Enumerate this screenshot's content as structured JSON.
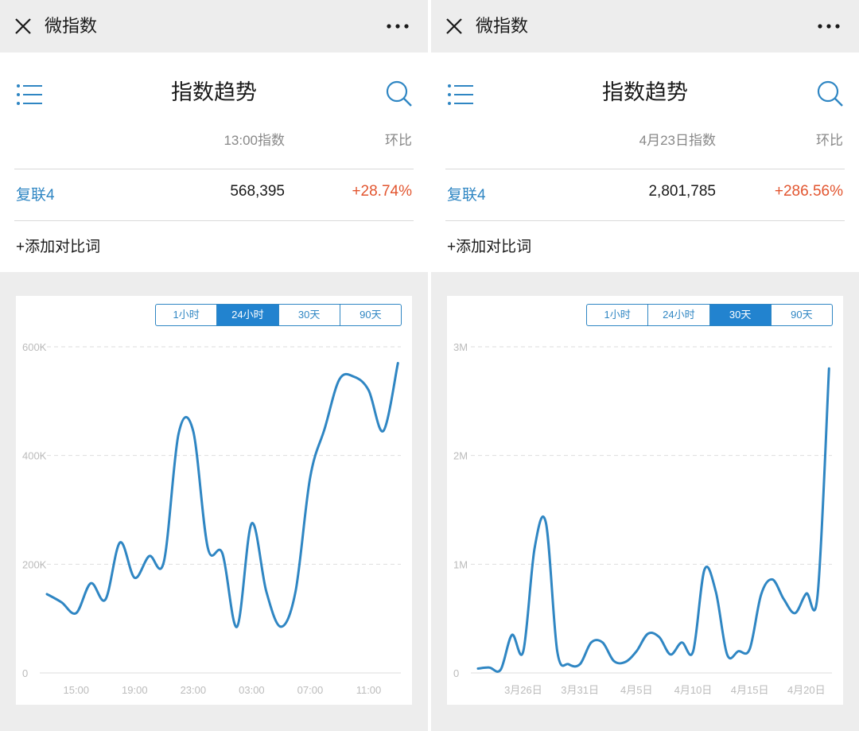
{
  "panels": [
    {
      "topbar_title": "微指数",
      "page_title": "指数趋势",
      "col_index_label": "13:00指数",
      "col_ratio_label": "环比",
      "row": {
        "name": "复联4",
        "value": "568,395",
        "change": "+28.74%"
      },
      "add_compare": "+添加对比词",
      "tabs": [
        "1小时",
        "24小时",
        "30天",
        "90天"
      ],
      "active_tab": 1,
      "chart_data": {
        "type": "line",
        "x_ticks": [
          "15:00",
          "19:00",
          "23:00",
          "03:00",
          "07:00",
          "11:00"
        ],
        "y_ticks": [
          "0",
          "200K",
          "400K",
          "600K"
        ],
        "ylim": [
          0,
          600000
        ],
        "grid": true,
        "series": [
          {
            "color": "#2f86c3",
            "points": [
              [
                0,
                145000
              ],
              [
                0.5,
                130000
              ],
              [
                1,
                110000
              ],
              [
                1.5,
                165000
              ],
              [
                2,
                135000
              ],
              [
                2.5,
                240000
              ],
              [
                3,
                175000
              ],
              [
                3.5,
                215000
              ],
              [
                4,
                205000
              ],
              [
                4.5,
                440000
              ],
              [
                5,
                445000
              ],
              [
                5.5,
                230000
              ],
              [
                6,
                220000
              ],
              [
                6.5,
                85000
              ],
              [
                7,
                275000
              ],
              [
                7.5,
                150000
              ],
              [
                8,
                85000
              ],
              [
                8.5,
                150000
              ],
              [
                9,
                360000
              ],
              [
                9.5,
                450000
              ],
              [
                10,
                540000
              ],
              [
                10.5,
                545000
              ],
              [
                11,
                520000
              ],
              [
                11.5,
                445000
              ],
              [
                12,
                570000
              ]
            ],
            "x_tick_positions": [
              1,
              3,
              5,
              7,
              9,
              11
            ]
          }
        ]
      }
    },
    {
      "topbar_title": "微指数",
      "page_title": "指数趋势",
      "col_index_label": "4月23日指数",
      "col_ratio_label": "环比",
      "row": {
        "name": "复联4",
        "value": "2,801,785",
        "change": "+286.56%"
      },
      "add_compare": "+添加对比词",
      "tabs": [
        "1小时",
        "24小时",
        "30天",
        "90天"
      ],
      "active_tab": 2,
      "chart_data": {
        "type": "line",
        "x_ticks": [
          "3月26日",
          "3月31日",
          "4月5日",
          "4月10日",
          "4月15日",
          "4月20日"
        ],
        "y_ticks": [
          "0",
          "1M",
          "2M",
          "3M"
        ],
        "ylim": [
          0,
          3000000
        ],
        "grid": true,
        "series": [
          {
            "color": "#2f86c3",
            "points": [
              [
                0,
                40000
              ],
              [
                1,
                50000
              ],
              [
                2,
                30000
              ],
              [
                3,
                350000
              ],
              [
                4,
                200000
              ],
              [
                5,
                1150000
              ],
              [
                6,
                1380000
              ],
              [
                7,
                200000
              ],
              [
                8,
                80000
              ],
              [
                9,
                80000
              ],
              [
                10,
                280000
              ],
              [
                11,
                280000
              ],
              [
                12,
                110000
              ],
              [
                13,
                100000
              ],
              [
                14,
                200000
              ],
              [
                15,
                360000
              ],
              [
                16,
                330000
              ],
              [
                17,
                170000
              ],
              [
                18,
                280000
              ],
              [
                19,
                200000
              ],
              [
                20,
                950000
              ],
              [
                21,
                750000
              ],
              [
                22,
                170000
              ],
              [
                23,
                200000
              ],
              [
                24,
                220000
              ],
              [
                25,
                720000
              ],
              [
                26,
                860000
              ],
              [
                27,
                680000
              ],
              [
                28,
                550000
              ],
              [
                29,
                730000
              ],
              [
                30,
                720000
              ],
              [
                31,
                2800000
              ]
            ],
            "x_tick_positions": [
              4,
              9,
              14,
              19,
              24,
              29
            ]
          }
        ]
      }
    }
  ]
}
